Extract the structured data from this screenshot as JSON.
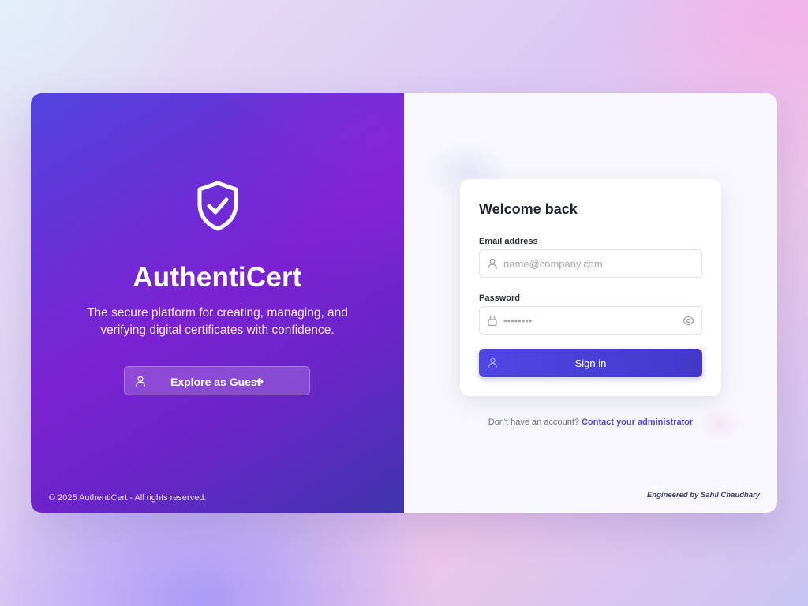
{
  "brand": {
    "name": "AuthentiCert",
    "tagline": "The secure platform for creating, managing, and verifying digital certificates with confidence.",
    "guest_button_label": "Explore as Guest",
    "copyright": "© 2025 AuthentiCert - All rights reserved."
  },
  "login": {
    "title": "Welcome back",
    "email_label": "Email address",
    "email_placeholder": "name@company.com",
    "email_value": "",
    "password_label": "Password",
    "password_placeholder": "••••••••",
    "password_value": "",
    "signin_label": "Sign in"
  },
  "footer": {
    "no_account_text": "Don't have an account?",
    "contact_link": "Contact your administrator",
    "engineered_by": "Engineered by Sahil Chaudhary"
  },
  "icons": {
    "brand_logo": "shield-check-icon",
    "guest_button": "user-icon",
    "guest_arrow": "arrow-right-icon",
    "email_field": "user-icon",
    "password_field": "lock-icon",
    "password_toggle": "eye-icon",
    "signin_button": "user-icon"
  },
  "colors": {
    "primary": "#4f46e5",
    "gradient_start": "#5143df",
    "gradient_mid": "#7b22d1",
    "gradient_end": "#3f35ad",
    "heading": "#1f2333"
  }
}
